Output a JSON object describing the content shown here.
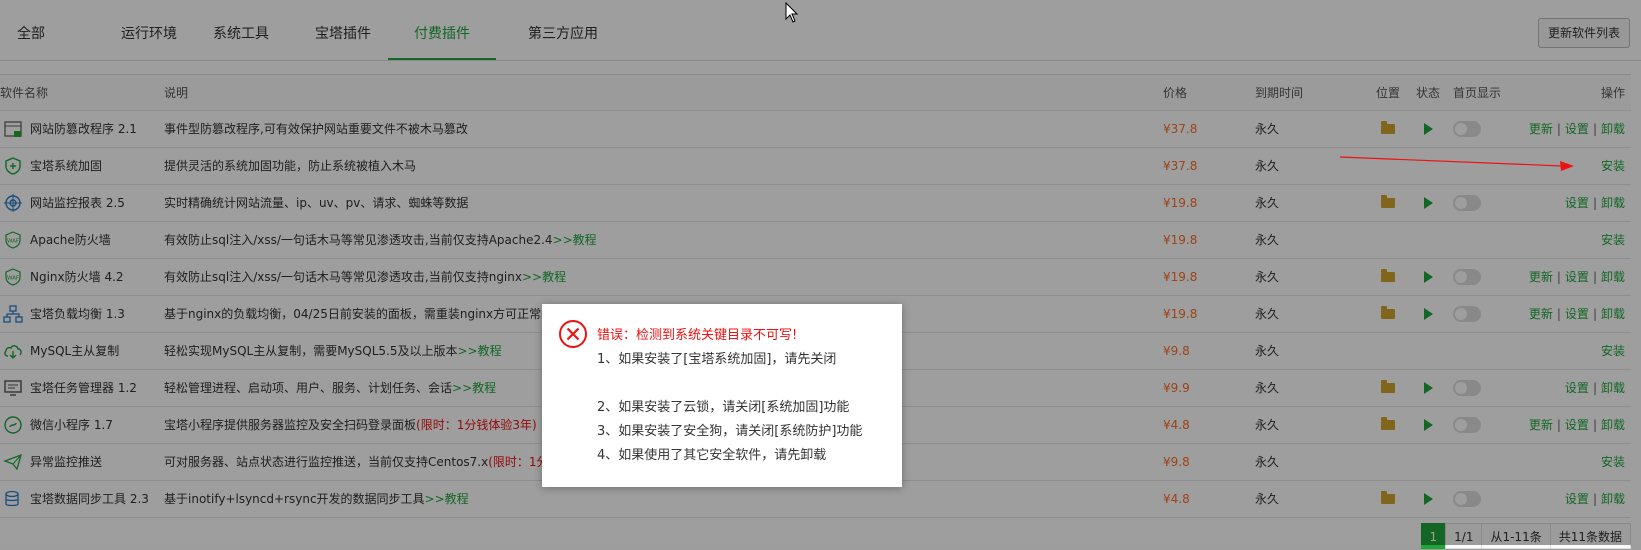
{
  "tabs": [
    "全部",
    "运行环境",
    "系统工具",
    "宝塔插件",
    "付费插件",
    "第三方应用"
  ],
  "active_tab": "付费插件",
  "refresh_button": "更新软件列表",
  "table": {
    "headers": {
      "name": "软件名称",
      "desc": "说明",
      "price": "价格",
      "expire": "到期时间",
      "position": "位置",
      "status": "状态",
      "home": "首页显示",
      "ops": "操作"
    },
    "rows": [
      {
        "name": "网站防篡改程序 2.1",
        "icon": "tamper-proof-icon",
        "desc": "事件型防篡改程序,可有效保护网站重要文件不被木马篡改",
        "link": "",
        "limit": "",
        "price": "¥37.8",
        "expire": "永久",
        "installed": true,
        "ops": [
          "更新",
          "设置",
          "卸载"
        ]
      },
      {
        "name": "宝塔系统加固",
        "icon": "shield-plus-icon",
        "desc": "提供灵活的系统加固功能，防止系统被植入木马",
        "link": "",
        "limit": "",
        "price": "¥37.8",
        "expire": "永久",
        "installed": false,
        "ops": [
          "安装"
        ]
      },
      {
        "name": "网站监控报表 2.5",
        "icon": "monitor-target-icon",
        "desc": "实时精确统计网站流量、ip、uv、pv、请求、蜘蛛等数据",
        "link": "",
        "limit": "",
        "price": "¥19.8",
        "expire": "永久",
        "installed": true,
        "ops": [
          "设置",
          "卸载"
        ]
      },
      {
        "name": "Apache防火墙",
        "icon": "waf-shield-icon",
        "desc": "有效防止sql注入/xss/一句话木马等常见渗透攻击,当前仅支持Apache2.4 ",
        "link": ">>教程",
        "limit": "",
        "price": "¥19.8",
        "expire": "永久",
        "installed": false,
        "ops": [
          "安装"
        ]
      },
      {
        "name": "Nginx防火墙 4.2",
        "icon": "waf-shield-icon",
        "desc": "有效防止sql注入/xss/一句话木马等常见渗透攻击,当前仅支持nginx ",
        "link": ">>教程",
        "limit": "",
        "price": "¥19.8",
        "expire": "永久",
        "installed": true,
        "ops": [
          "更新",
          "设置",
          "卸载"
        ]
      },
      {
        "name": "宝塔负载均衡 1.3",
        "icon": "load-balance-icon",
        "desc": "基于nginx的负载均衡，04/25日前安装的面板，需重装nginx方可正常",
        "link": "",
        "limit": "",
        "price": "¥19.8",
        "expire": "永久",
        "installed": true,
        "ops": [
          "更新",
          "设置",
          "卸载"
        ]
      },
      {
        "name": "MySQL主从复制",
        "icon": "cloud-sync-icon",
        "desc": "轻松实现MySQL主从复制，需要MySQL5.5及以上版本",
        "link": ">>教程",
        "limit": "",
        "price": "¥9.8",
        "expire": "永久",
        "installed": false,
        "ops": [
          "安装"
        ]
      },
      {
        "name": "宝塔任务管理器 1.2",
        "icon": "task-manager-icon",
        "desc": "轻松管理进程、启动项、用户、服务、计划任务、会话 ",
        "link": ">>教程",
        "limit": "",
        "price": "¥9.9",
        "expire": "永久",
        "installed": true,
        "ops": [
          "设置",
          "卸载"
        ]
      },
      {
        "name": "微信小程序 1.7",
        "icon": "wechat-miniapp-icon",
        "desc": "宝塔小程序提供服务器监控及安全扫码登录面板 ",
        "link": "",
        "limit": "(限时：1分钱体验3年)",
        "price": "¥4.8",
        "expire": "永久",
        "installed": true,
        "ops": [
          "更新",
          "设置",
          "卸载"
        ]
      },
      {
        "name": "异常监控推送",
        "icon": "push-notify-icon",
        "desc": "可对服务器、站点状态进行监控推送，当前仅支持Centos7.x ",
        "link": "",
        "limit": "(限时：1分",
        "price": "¥9.8",
        "expire": "永久",
        "installed": false,
        "ops": [
          "安装"
        ]
      },
      {
        "name": "宝塔数据同步工具 2.3",
        "icon": "database-sync-icon",
        "desc": "基于inotify+lsyncd+rsync开发的数据同步工具 ",
        "link": ">>教程",
        "limit": "",
        "price": "¥4.8",
        "expire": "永久",
        "installed": true,
        "ops": [
          "设置",
          "卸载"
        ]
      }
    ]
  },
  "pager": {
    "current": "1",
    "pages": "1/1",
    "range": "从1-11条",
    "total": "共11条数据"
  },
  "dialog": {
    "title": "错误：检测到系统关键目录不可写!",
    "lines": [
      "1、如果安装了[宝塔系统加固]，请先关闭",
      "",
      "2、如果安装了云锁，请关闭[系统加固]功能",
      "3、如果安装了安全狗，请关闭[系统防护]功能",
      "4、如果使用了其它安全软件，请先卸载"
    ]
  },
  "colors": {
    "accent": "#20a53a",
    "price": "#fc6d26",
    "error": "#e11",
    "arrow": "#e11"
  }
}
